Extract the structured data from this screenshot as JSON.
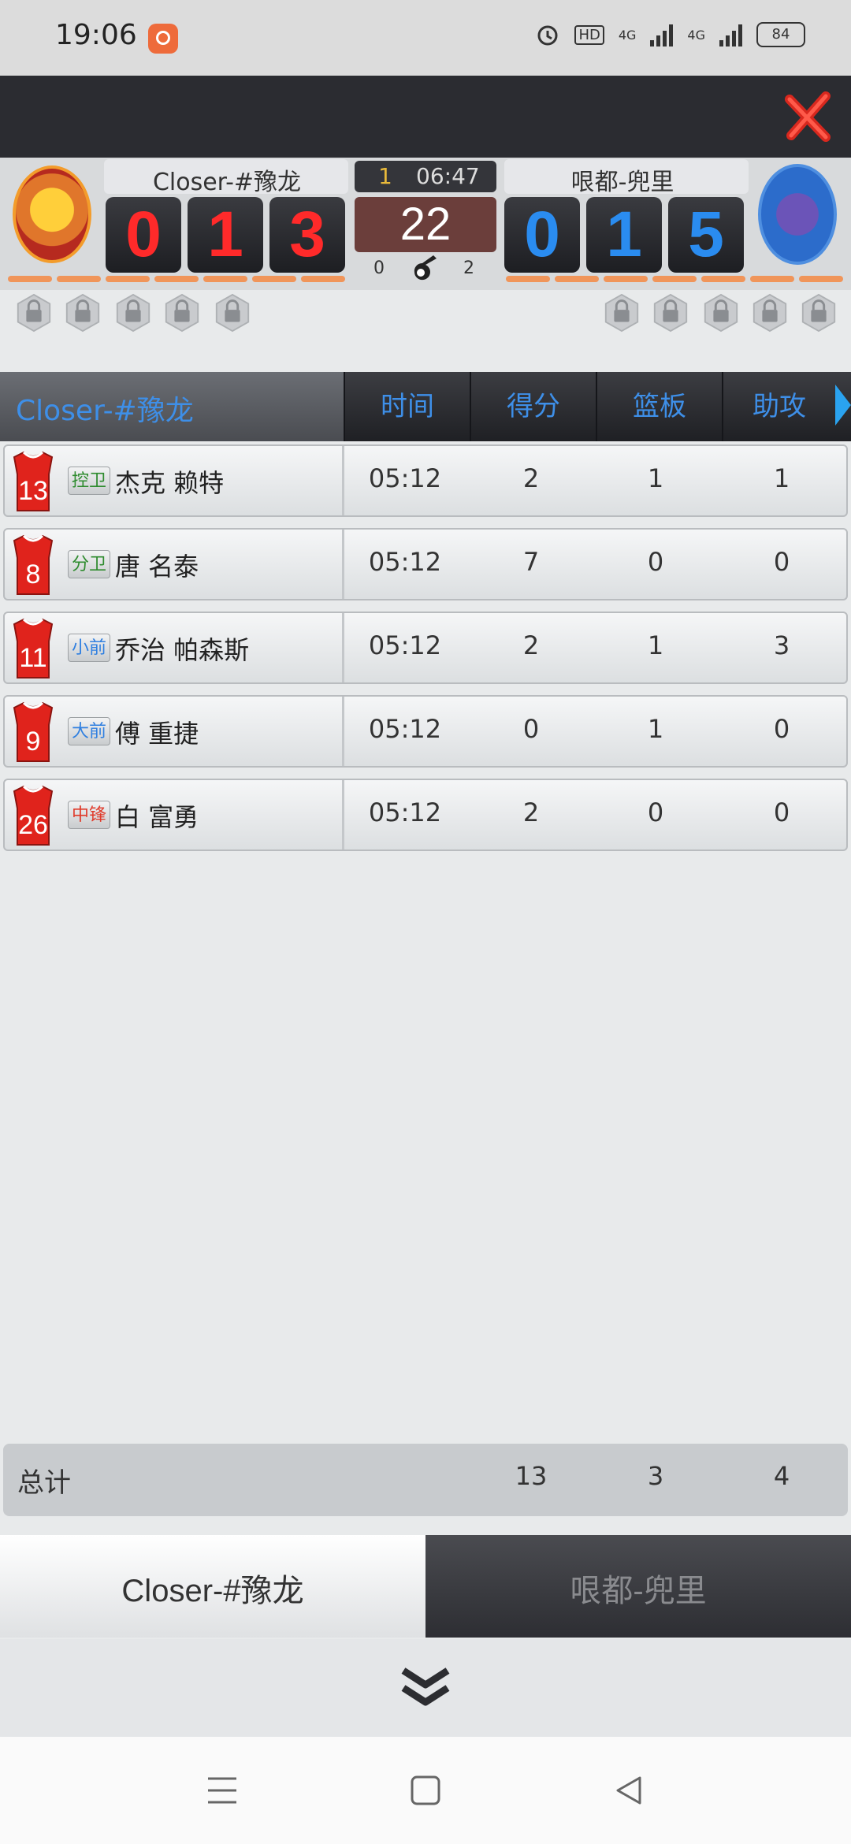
{
  "status_bar": {
    "time": "19:06",
    "battery": "84",
    "network1": "4G",
    "network2": "4G",
    "hd": "HD"
  },
  "scoreboard": {
    "home_team": "Closer-#豫龙",
    "away_team": "哏都-兜里",
    "home_digits": [
      "0",
      "1",
      "3"
    ],
    "away_digits": [
      "0",
      "1",
      "5"
    ],
    "quarter": "1",
    "clock": "06:47",
    "shot_clock": "22",
    "possession_left": "0",
    "possession_right": "2"
  },
  "table": {
    "team_header": "Closer-#豫龙",
    "columns": [
      "时间",
      "得分",
      "篮板",
      "助攻"
    ],
    "rows": [
      {
        "number": "13",
        "position": "控卫",
        "pos_color": "#2e8b2e",
        "name": "杰克 赖特",
        "time": "05:12",
        "points": "2",
        "rebounds": "1",
        "assists": "1"
      },
      {
        "number": "8",
        "position": "分卫",
        "pos_color": "#2e8b2e",
        "name": "唐 名泰",
        "time": "05:12",
        "points": "7",
        "rebounds": "0",
        "assists": "0"
      },
      {
        "number": "11",
        "position": "小前",
        "pos_color": "#2f7fe0",
        "name": "乔治 帕森斯",
        "time": "05:12",
        "points": "2",
        "rebounds": "1",
        "assists": "3"
      },
      {
        "number": "9",
        "position": "大前",
        "pos_color": "#2f7fe0",
        "name": "傅 重捷",
        "time": "05:12",
        "points": "0",
        "rebounds": "1",
        "assists": "0"
      },
      {
        "number": "26",
        "position": "中锋",
        "pos_color": "#e03a2a",
        "name": "白 富勇",
        "time": "05:12",
        "points": "2",
        "rebounds": "0",
        "assists": "0"
      }
    ],
    "totals_label": "总计",
    "totals": {
      "points": "13",
      "rebounds": "3",
      "assists": "4"
    }
  },
  "tabs": {
    "left": "Closer-#豫龙",
    "right": "哏都-兜里"
  },
  "colors": {
    "home_red": "#ff2a2a",
    "away_blue": "#2a8cf0",
    "header_blue": "#3e8fe8"
  }
}
